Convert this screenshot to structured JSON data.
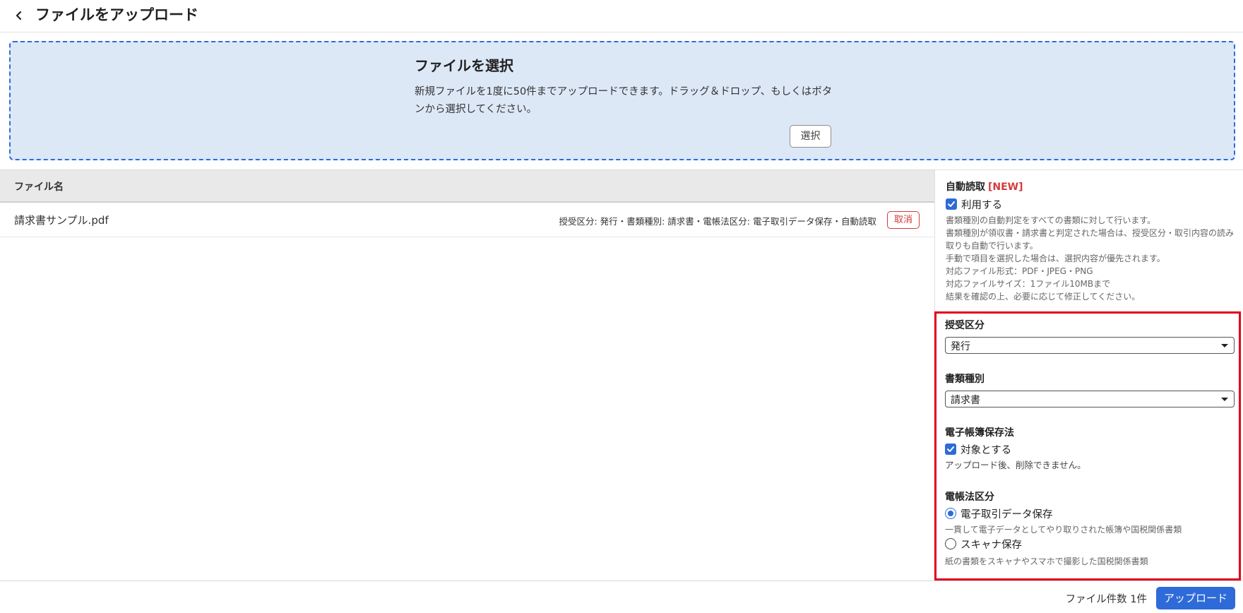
{
  "header": {
    "title": "ファイルをアップロード"
  },
  "dropzone": {
    "title": "ファイルを選択",
    "description": "新規ファイルを1度に50件までアップロードできます。ドラッグ＆ドロップ、もしくはボタンから選択してください。",
    "select_label": "選択"
  },
  "table": {
    "header_file_name": "ファイル名",
    "rows": [
      {
        "file_name": "請求書サンプル.pdf",
        "meta": "授受区分: 発行・書類種別: 請求書・電帳法区分: 電子取引データ保存・自動読取",
        "cancel_label": "取消"
      }
    ]
  },
  "panel": {
    "auto": {
      "title": "自動読取",
      "badge": "[NEW]",
      "checkbox_label": "利用する",
      "checked": true,
      "help": [
        "書類種別の自動判定をすべての書類に対して行います。",
        "書類種別が領収書・請求書と判定された場合は、授受区分・取引内容の読み取りも自動で行います。",
        "手動で項目を選択した場合は、選択内容が優先されます。",
        "対応ファイル形式：PDF・JPEG・PNG",
        "対応ファイルサイズ：1ファイル10MBまで",
        "結果を確認の上、必要に応じて修正してください。"
      ]
    },
    "transfer_type": {
      "label": "授受区分",
      "value": "発行"
    },
    "doc_type": {
      "label": "書類種別",
      "value": "請求書"
    },
    "ebook_law": {
      "label": "電子帳簿保存法",
      "checkbox_label": "対象とする",
      "checked": true,
      "help": "アップロード後、削除できません。"
    },
    "ebook_category": {
      "label": "電帳法区分",
      "options": [
        {
          "label": "電子取引データ保存",
          "help": "一貫して電子データとしてやり取りされた帳簿や国税関係書類",
          "checked": true
        },
        {
          "label": "スキャナ保存",
          "help": "紙の書類をスキャナやスマホで撮影した国税関係書類",
          "checked": false
        }
      ]
    }
  },
  "footer": {
    "file_count": "ファイル件数 1件",
    "upload_label": "アップロード"
  },
  "colors": {
    "accent": "#2f6bd8",
    "danger": "#d23b3b",
    "highlight": "#e0001b",
    "dropzone_bg": "#dde8f7"
  }
}
